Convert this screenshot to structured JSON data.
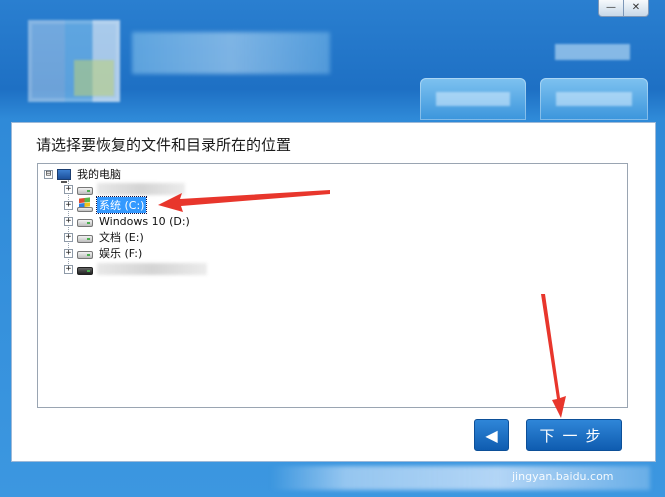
{
  "window": {
    "minimize_glyph": "—",
    "close_glyph": "✕"
  },
  "prompt": "请选择要恢复的文件和目录所在的位置",
  "tree": {
    "root": {
      "label": "我的电脑",
      "expander": "⊟"
    },
    "items": [
      {
        "label": "",
        "blurred": true,
        "icon": "drive-icon",
        "expander": "+"
      },
      {
        "label": "系统 (C:)",
        "icon": "windows-drive-icon",
        "expander": "+",
        "selected": true
      },
      {
        "label": "Windows 10 (D:)",
        "icon": "drive-icon",
        "expander": "+"
      },
      {
        "label": "文档 (E:)",
        "icon": "drive-icon",
        "expander": "+"
      },
      {
        "label": "娱乐 (F:)",
        "icon": "drive-icon",
        "expander": "+"
      },
      {
        "label": "",
        "blurred": true,
        "icon": "removable-drive-icon",
        "expander": "+"
      }
    ]
  },
  "buttons": {
    "back_glyph": "◀",
    "next_label": "下一步"
  },
  "watermark": "jingyan.baidu.com",
  "colors": {
    "accent": "#1e70c4",
    "selection": "#3399ff",
    "annotation_arrow": "#e8362c"
  }
}
